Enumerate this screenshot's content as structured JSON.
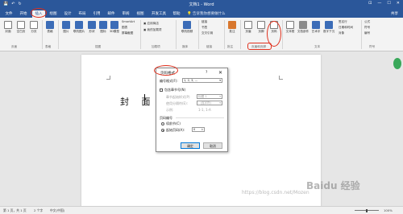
{
  "titlebar": {
    "title": "文档1 - Word",
    "qat": [
      "💾",
      "↶",
      "↻"
    ],
    "win": [
      "⊡",
      "—",
      "☐",
      "✕"
    ]
  },
  "tabs": [
    "文件",
    "开始",
    "插入",
    "绘图",
    "设计",
    "布局",
    "引用",
    "邮件",
    "审阅",
    "视图",
    "开发工具",
    "帮助"
  ],
  "active_tab": 2,
  "tellme": "告诉我你想要做什么",
  "share": "共享",
  "ribbon": {
    "buttons": [
      {
        "label": "封面",
        "color": "page"
      },
      {
        "label": "空白页",
        "color": "page"
      },
      {
        "label": "分页",
        "color": "page"
      },
      {
        "label": "表格",
        "color": "blue"
      },
      {
        "label": "图片",
        "color": "blue"
      },
      {
        "label": "联机图片",
        "color": "blue"
      },
      {
        "label": "形状",
        "color": "blue"
      },
      {
        "label": "图标",
        "color": "blue"
      },
      {
        "label": "3D模型",
        "color": "blue"
      },
      {
        "label": "联机视频",
        "color": "blue"
      },
      {
        "label": "页眉",
        "color": "page"
      },
      {
        "label": "页脚",
        "color": "page"
      },
      {
        "label": "页码",
        "color": "page"
      },
      {
        "label": "文本框",
        "color": "page"
      },
      {
        "label": "文档部件",
        "color": "grey"
      },
      {
        "label": "艺术字",
        "color": "blue"
      },
      {
        "label": "首字下沉",
        "color": "blue"
      },
      {
        "label": "公式",
        "color": "grey"
      },
      {
        "label": "符号",
        "color": "grey"
      }
    ],
    "small_items": [
      "SmartArt",
      "图表",
      "屏幕截图",
      "应用商店",
      "我的加载项",
      "链接",
      "书签",
      "交叉引用",
      "批注",
      "签名行",
      "日期和时间",
      "对象",
      "编号"
    ],
    "groups": [
      "页面",
      "表格",
      "插图",
      "加载项",
      "媒体",
      "链接",
      "批注",
      "页眉和页脚",
      "文本",
      "符号"
    ]
  },
  "document": {
    "cover_text": "封 面"
  },
  "dialog": {
    "title": "页码格式",
    "help": "?",
    "close": "✕",
    "number_format_label": "编号格式(F):",
    "number_format_value": "1, 2, 3, ...",
    "include_chapter_label": "包含章节号(N)",
    "chapter_style_label": "章节起始样式(P)",
    "chapter_style_value": "标题 1",
    "separator_label": "使用分隔符(E):",
    "separator_value": "- (连字符)",
    "example_label": "示例:",
    "example_value": "1-1, 1-A",
    "numbering_heading": "页码编号",
    "continue_label": "续前节(C)",
    "start_at_label": "起始页码(A):",
    "start_at_value": "0",
    "ok": "确定",
    "cancel": "取消"
  },
  "statusbar": {
    "page": "第 1 页，共 1 页",
    "words": "2 个字",
    "lang": "中文(中国)",
    "zoom": "100%"
  },
  "watermark": {
    "brand": "Baidu 经验",
    "url": "https://blog.csdn.net/Mozen"
  }
}
